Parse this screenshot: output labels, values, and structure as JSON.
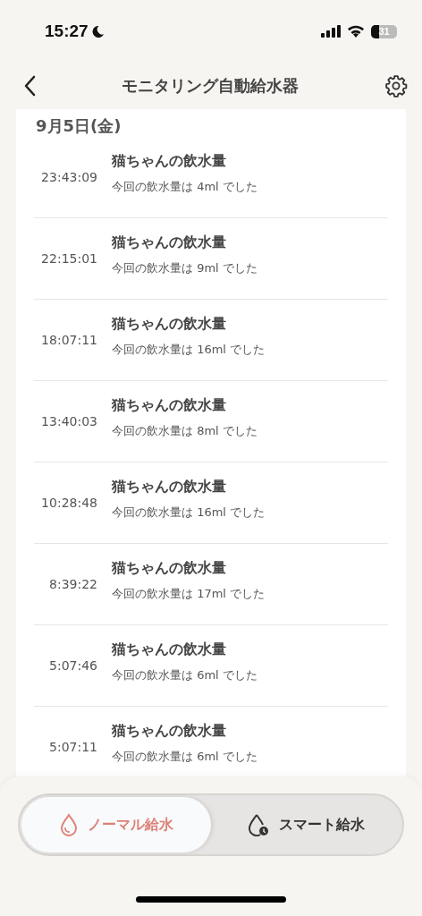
{
  "status_bar": {
    "time": "15:27",
    "battery": "31"
  },
  "header": {
    "title": "モニタリング自動給水器"
  },
  "date": "9月5日(金)",
  "records": [
    {
      "time": "23:43:09",
      "title": "猫ちゃんの飲水量",
      "detail": "今回の飲水量は 4ml でした"
    },
    {
      "time": "22:15:01",
      "title": "猫ちゃんの飲水量",
      "detail": "今回の飲水量は 9ml でした"
    },
    {
      "time": "18:07:11",
      "title": "猫ちゃんの飲水量",
      "detail": "今回の飲水量は 16ml でした"
    },
    {
      "time": "13:40:03",
      "title": "猫ちゃんの飲水量",
      "detail": "今回の飲水量は 8ml でした"
    },
    {
      "time": "10:28:48",
      "title": "猫ちゃんの飲水量",
      "detail": "今回の飲水量は 16ml でした"
    },
    {
      "time": "8:39:22",
      "title": "猫ちゃんの飲水量",
      "detail": "今回の飲水量は 17ml でした"
    },
    {
      "time": "5:07:46",
      "title": "猫ちゃんの飲水量",
      "detail": "今回の飲水量は 6ml でした"
    },
    {
      "time": "5:07:11",
      "title": "猫ちゃんの飲水量",
      "detail": "今回の飲水量は 6ml でした"
    }
  ],
  "modes": [
    {
      "kind": "normal",
      "label": "ノーマル給水",
      "selected": true
    },
    {
      "kind": "smart",
      "label": "スマート給水",
      "selected": false
    }
  ]
}
